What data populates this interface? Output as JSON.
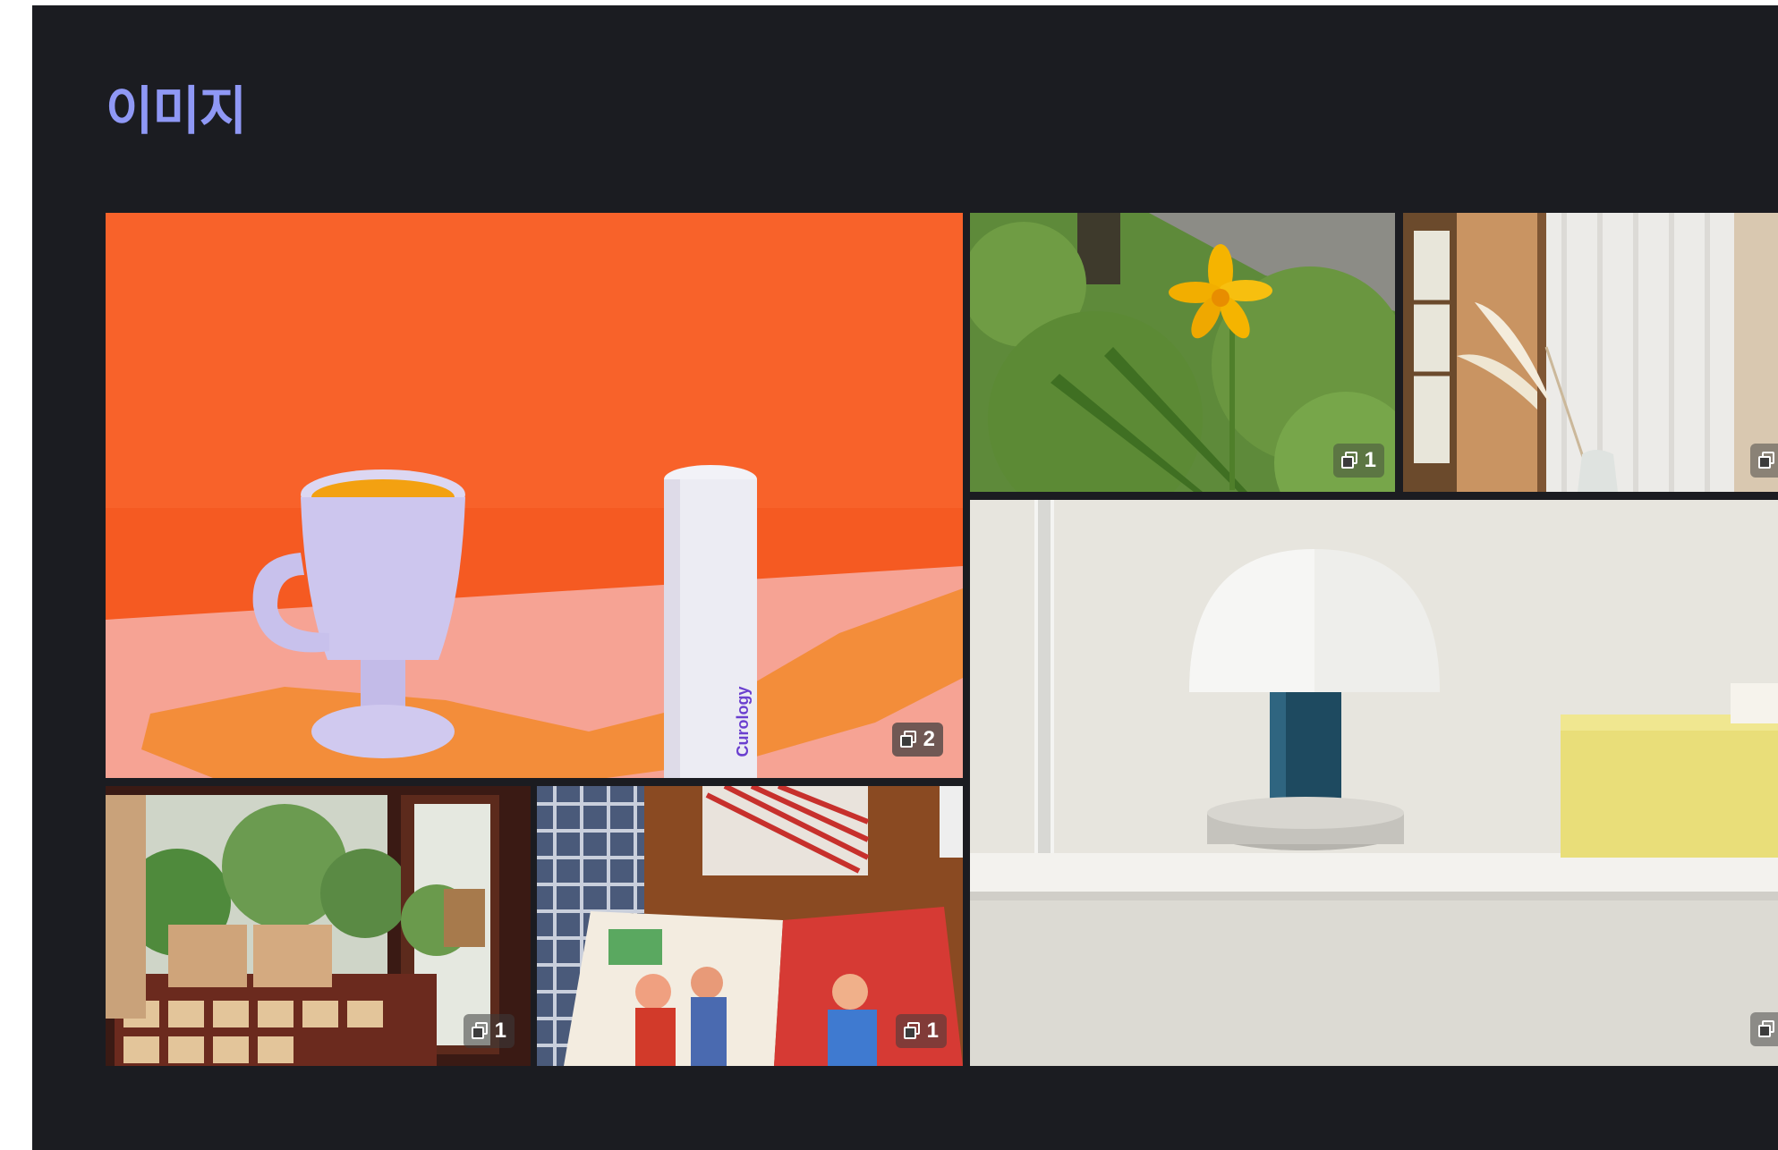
{
  "section": {
    "title": "이미지"
  },
  "gallery": {
    "items": [
      {
        "name": "orange-cup-bottle",
        "count": "2",
        "bottle_label": "Curology"
      },
      {
        "name": "yellow-lily",
        "count": "1"
      },
      {
        "name": "pampas-vase-room",
        "count": ""
      },
      {
        "name": "postcard-shop",
        "count": "1"
      },
      {
        "name": "illustrated-book",
        "count": "1"
      },
      {
        "name": "mushroom-lamp-shelf",
        "count": ""
      }
    ]
  },
  "colors": {
    "panel_bg": "#1b1c21",
    "title": "#8f98f5"
  }
}
